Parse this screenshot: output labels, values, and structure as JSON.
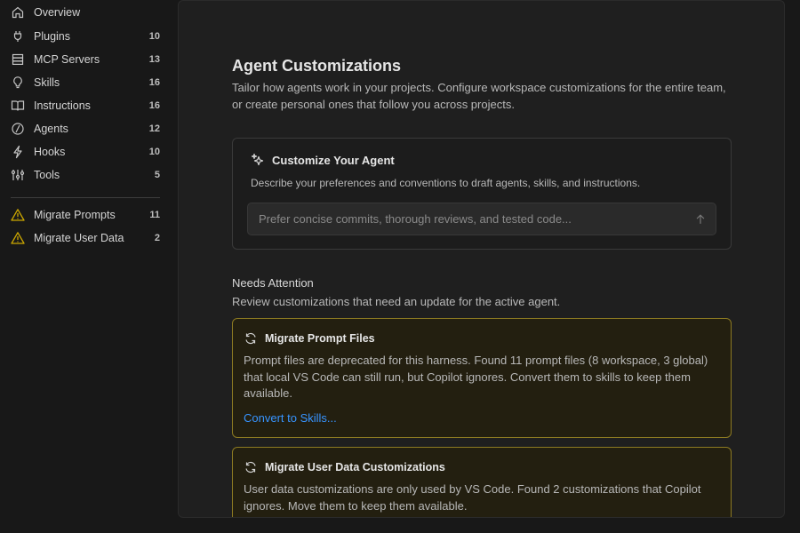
{
  "sidebar": {
    "items": [
      {
        "label": "Overview",
        "count": "",
        "icon": "home-icon"
      },
      {
        "label": "Plugins",
        "count": "10",
        "icon": "plug-icon"
      },
      {
        "label": "MCP Servers",
        "count": "13",
        "icon": "server-icon"
      },
      {
        "label": "Skills",
        "count": "16",
        "icon": "lightbulb-icon"
      },
      {
        "label": "Instructions",
        "count": "16",
        "icon": "book-icon"
      },
      {
        "label": "Agents",
        "count": "12",
        "icon": "agent-icon"
      },
      {
        "label": "Hooks",
        "count": "10",
        "icon": "lightning-icon"
      },
      {
        "label": "Tools",
        "count": "5",
        "icon": "tools-icon"
      }
    ],
    "migrate_items": [
      {
        "label": "Migrate Prompts",
        "count": "11",
        "icon": "warning-icon"
      },
      {
        "label": "Migrate User Data",
        "count": "2",
        "icon": "warning-icon"
      }
    ]
  },
  "main": {
    "title": "Agent Customizations",
    "description": "Tailor how agents work in your projects. Configure workspace customizations for the entire team, or create personal ones that follow you across projects.",
    "customize": {
      "title": "Customize Your Agent",
      "description": "Describe your preferences and conventions to draft agents, skills, and instructions.",
      "placeholder": "Prefer concise commits, thorough reviews, and tested code..."
    },
    "attention": {
      "title": "Needs Attention",
      "description": "Review customizations that need an update for the active agent.",
      "cards": [
        {
          "title": "Migrate Prompt Files",
          "body": "Prompt files are deprecated for this harness. Found 11 prompt files (8 workspace, 3 global) that local VS Code can still run, but Copilot ignores. Convert them to skills to keep them available.",
          "link": "Convert to Skills..."
        },
        {
          "title": "Migrate User Data Customizations",
          "body": "User data customizations are only used by VS Code. Found 2 customizations that Copilot ignores. Move them to keep them available."
        }
      ]
    }
  },
  "colors": {
    "background": "#181818",
    "panel": "#1f1f1f",
    "warning_border": "#8c7a22",
    "warning_icon": "#cca700",
    "link": "#3794ff"
  }
}
